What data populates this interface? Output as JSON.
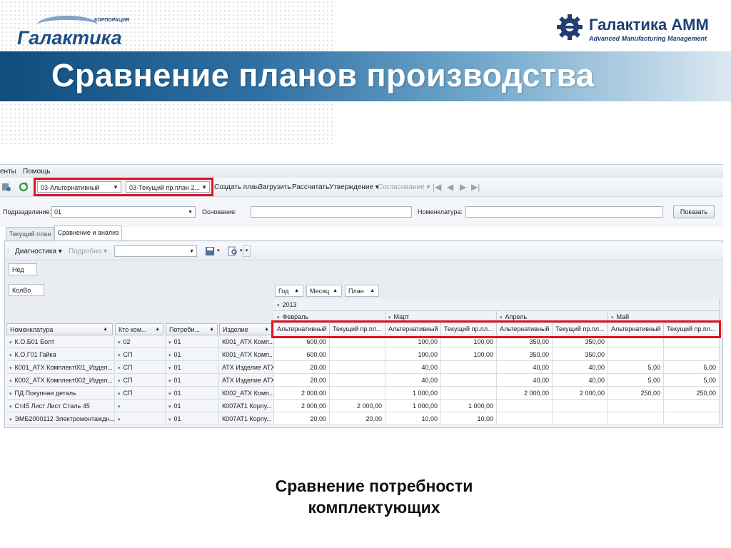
{
  "slide": {
    "title": "Сравнение планов производства",
    "caption_line1": "Сравнение потребности",
    "caption_line2": "комплектующих"
  },
  "logos": {
    "left_corp": "КОРПОРАЦИЯ",
    "left_name": "Галактика",
    "right_name": "Галактика АММ",
    "right_sub": "Advanced Manufacturing Management"
  },
  "menu": {
    "items": [
      "енты",
      "Помощь"
    ]
  },
  "toolbar": {
    "plan_alt": "03-Альтернативный",
    "plan_cur": "03-Текущий пр.план 2...",
    "create": "Создать план",
    "load": "Загрузить",
    "calc": "Рассчитать",
    "approve": "Утверждение",
    "agree": "Согласование"
  },
  "filters": {
    "dept_label": "Подразделение:",
    "dept_value": "01",
    "basis_label": "Основание:",
    "nom_label": "Номенклатура:",
    "show_button": "Показать"
  },
  "tabs": {
    "current": "Текущий план",
    "compare": "Сравнение и анализ"
  },
  "subtoolbar": {
    "diag": "Диагностика",
    "detail": "Подробно"
  },
  "pivot": {
    "filter_chip": "Нед",
    "data_chip": "КолВо",
    "col_chips": [
      "Год",
      "Месяц",
      "План"
    ],
    "year": "2013",
    "months": [
      "Февраль",
      "Март",
      "Апрель",
      "Май"
    ],
    "plan_alt": "Альтернативный",
    "plan_cur": "Текущий пр.пл...",
    "row_headers": [
      "Номенклатура",
      "Кто ком...",
      "Потреби...",
      "Изделие"
    ],
    "rows": [
      {
        "nom": "К.О.Б01 Болт",
        "who": "02",
        "cons": "01",
        "prod": "К001_АТХ Комп...",
        "v": [
          "600,00",
          "",
          "100,00",
          "100,00",
          "350,00",
          "350,00",
          "",
          ""
        ]
      },
      {
        "nom": "К.О.Г01 Гайка",
        "who": "СП",
        "cons": "01",
        "prod": "К001_АТХ Комп...",
        "v": [
          "600,00",
          "",
          "100,00",
          "100,00",
          "350,00",
          "350,00",
          "",
          ""
        ]
      },
      {
        "nom": "К001_АТХ Комплект001_Издел...",
        "who": "СП",
        "cons": "01",
        "prod": "АТХ Изделие АТХ",
        "v": [
          "20,00",
          "",
          "40,00",
          "",
          "40,00",
          "40,00",
          "5,00",
          "5,00"
        ]
      },
      {
        "nom": "К002_АТХ Комплект002_Издел...",
        "who": "СП",
        "cons": "01",
        "prod": "АТХ Изделие АТХ",
        "v": [
          "20,00",
          "",
          "40,00",
          "",
          "40,00",
          "40,00",
          "5,00",
          "5,00"
        ]
      },
      {
        "nom": "ПД Покупная деталь",
        "who": "СП",
        "cons": "01",
        "prod": "К002_АТХ Комп...",
        "v": [
          "2 000,00",
          "",
          "1 000,00",
          "",
          "2 000,00",
          "2 000,00",
          "250,00",
          "250,00"
        ]
      },
      {
        "nom": "Ст45 Лист Лист Сталь 45",
        "who": "",
        "cons": "01",
        "prod": "К007АТ1 Корпу...",
        "v": [
          "2 000,00",
          "2 000,00",
          "1 000,00",
          "1 000,00",
          "",
          "",
          "",
          ""
        ]
      },
      {
        "nom": "ЭМБ2000112 Электромонтаждн...",
        "who": "",
        "cons": "01",
        "prod": "К007АТ1 Корпу...",
        "v": [
          "20,00",
          "20,00",
          "10,00",
          "10,00",
          "",
          "",
          "",
          ""
        ]
      }
    ]
  },
  "colors": {
    "highlight": "#e0141e",
    "banner": "#1f5b8c"
  },
  "icons": [
    "refresh-icon",
    "user-settings-icon",
    "first-page-icon",
    "prev-page-icon",
    "next-page-icon",
    "last-page-icon",
    "save-icon",
    "find-icon"
  ]
}
